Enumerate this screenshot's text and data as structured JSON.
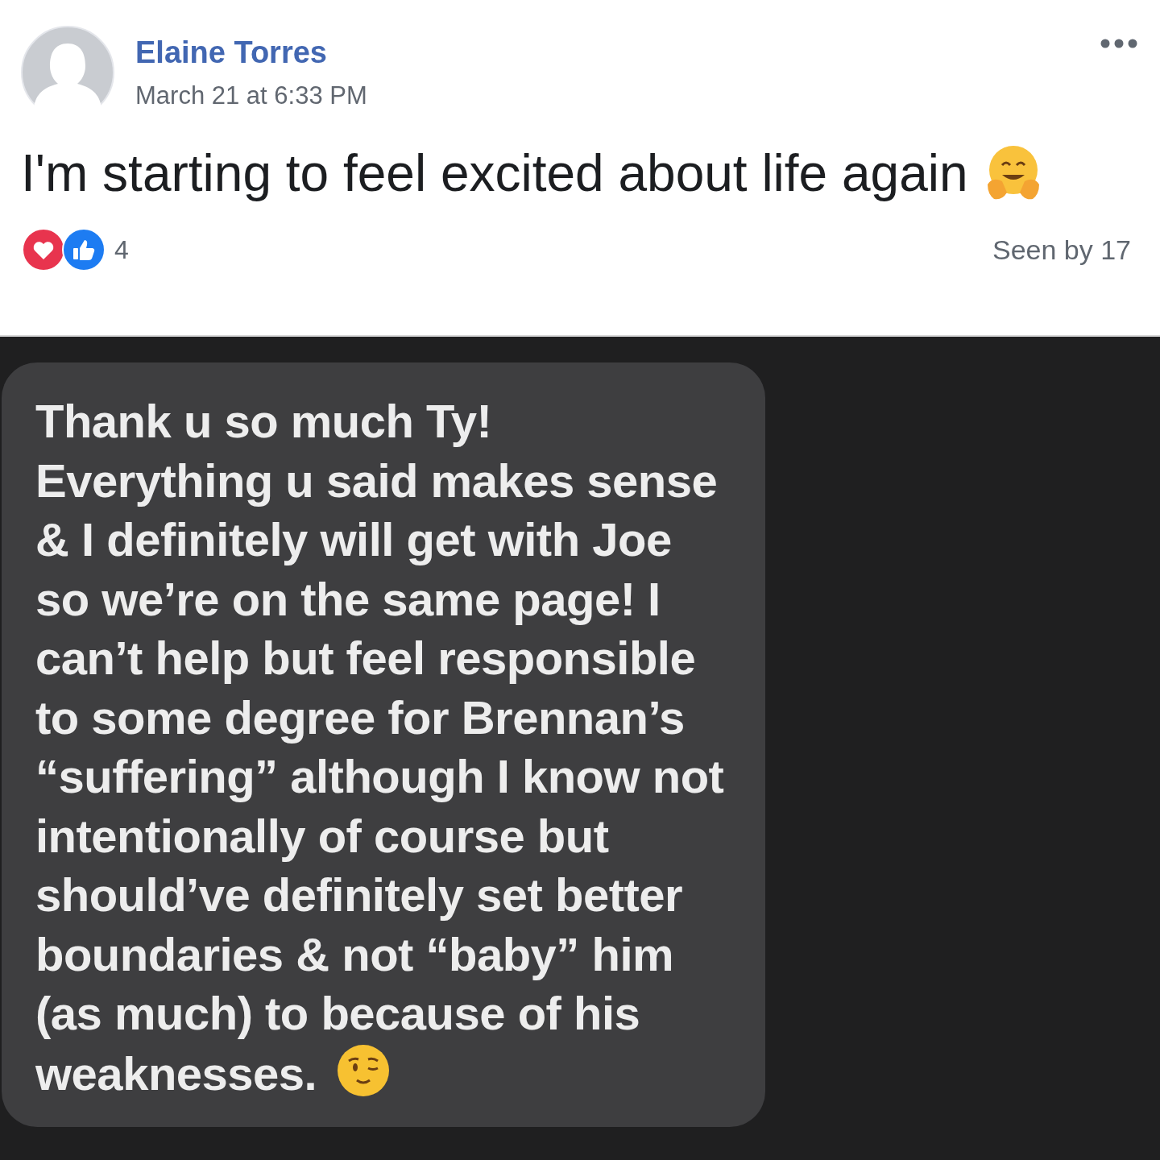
{
  "post": {
    "author": "Elaine Torres",
    "timestamp": "March 21 at 6:33 PM",
    "text": "I'm starting to feel excited about life again",
    "reactions": {
      "items": [
        {
          "kind": "love"
        },
        {
          "kind": "like"
        }
      ],
      "count": "4"
    },
    "seen_by": "Seen by 17"
  },
  "message": {
    "lines": [
      "Thank u so much Ty!",
      "Everything u said makes sense",
      "& I definitely will get with Joe",
      "so we’re on the same page! I",
      "can’t help but feel responsible",
      "to some degree for Brennan’s",
      "“suffering” although I know not",
      "intentionally of course but",
      "should’ve definitely set better",
      "boundaries & not “baby” him",
      "(as much) to because of his",
      "weaknesses."
    ]
  }
}
